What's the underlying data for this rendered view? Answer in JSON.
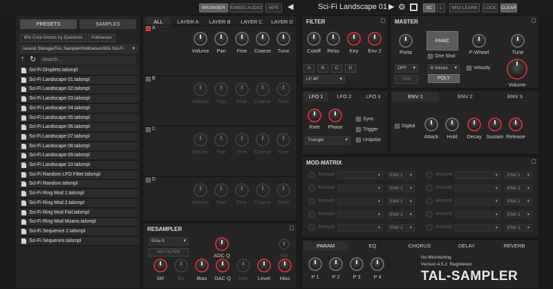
{
  "topbar": {
    "browser": "BROWSER",
    "embed_audio": "EMBED AUDIO",
    "mpe": "MPE",
    "preset_name": "Sci-Fi Landscape 01",
    "sc": "SC",
    "l": "L",
    "midi_learn": "MIDI LEARN",
    "lock": "LOCK",
    "clear": "CLEAR"
  },
  "sidebar": {
    "tabs": [
      "PRESETS",
      "SAMPLES"
    ],
    "chips": [
      "80s Core Drums by Quickmix",
      "Hollowsun"
    ],
    "path": "/sound Storage/TAL Sampler/Hollowsun/50s Sci-Fi",
    "search_placeholder": "Search...",
    "files": [
      "Sci-Fi Droplets.talsmpl",
      "Sci-Fi Landscape 01.talsmpl",
      "Sci-Fi Landscape 02.talsmpl",
      "Sci-Fi Landscape 03.talsmpl",
      "Sci-Fi Landscape 04.talsmpl",
      "Sci-Fi Landscape 05.talsmpl",
      "Sci-Fi Landscape 06.talsmpl",
      "Sci-Fi Landscape 07.talsmpl",
      "Sci-Fi Landscape 08.talsmpl",
      "Sci-Fi Landscape 09.talsmpl",
      "Sci-Fi Landscape 10.talsmpl",
      "Sci-Fi Random LFO Filter.talsmpl",
      "Sci-Fi Random.talsmpl",
      "Sci-Fi Ring Mod 1.talsmpl",
      "Sci-Fi Ring Mod 2.talsmpl",
      "Sci-Fi Ring Mod Fail.talsmpl",
      "Sci-Fi Ring Mod Moans.talsmpl",
      "Sci-Fi Sequence 2.talsmpl",
      "Sci-Fi Sequence.talsmpl"
    ]
  },
  "layers": {
    "tabs": [
      "ALL",
      "LAYER A",
      "LAYER B",
      "LAYER C",
      "LAYER D"
    ],
    "rows": [
      {
        "id": "A"
      },
      {
        "id": "B"
      },
      {
        "id": "C"
      },
      {
        "id": "D"
      }
    ],
    "knob_labels": [
      "Volume",
      "Pan",
      "Fine",
      "Coarse",
      "Tune"
    ]
  },
  "resampler": {
    "title": "RESAMPLER",
    "mode": "Emu II",
    "no_filter": "NO FILTER",
    "adc_q": "ADC Q",
    "sat": "Sat",
    "knobs": [
      "SR",
      "8/s",
      "Bias",
      "DAC Q",
      "Jitter",
      "Level",
      "Hiss"
    ]
  },
  "filter": {
    "title": "FILTER",
    "knobs": [
      "Cutoff",
      "Reso",
      "Key",
      "Env 2"
    ],
    "modes": [
      "A",
      "B",
      "C",
      "D"
    ],
    "type": "LP 4P"
  },
  "master": {
    "title": "MASTER",
    "porta": "Porta",
    "panic": "PANIC",
    "one_shot": "One Shot",
    "pwheel": "P-Wheel",
    "tune": "Tune",
    "off": "OFF",
    "voices": "8 Voices",
    "velocity": "Velocity",
    "time": "TIME",
    "poly": "POLY",
    "volume": "Volume"
  },
  "lfo": {
    "tabs": [
      "LFO 1",
      "LFO 2",
      "LFO 3"
    ],
    "rate": "Rate",
    "phase": "Phase",
    "sync": "Sync",
    "trigger": "Trigger",
    "unipolar": "Unipolar",
    "wave": "Triangle"
  },
  "env": {
    "tabs": [
      "ENV 1",
      "ENV 2",
      "ENV 3"
    ],
    "digital": "Digital",
    "knobs": [
      "Attack",
      "Hold",
      "Decay",
      "Sustain",
      "Release"
    ]
  },
  "modmatrix": {
    "title": "MOD-MATRIX",
    "amount": "Amount",
    "env": "ENV 1"
  },
  "bottom": {
    "tabs": [
      "PARAM",
      "EQ",
      "CHORUS",
      "DELAY",
      "REVERB"
    ],
    "no_microtuning": "No Microtuning",
    "version": "Version 4.5.2: Registered",
    "brand": "TAL-SAMPLER",
    "params": [
      "P 1",
      "P 2",
      "P 3",
      "P 4"
    ]
  },
  "colors": {
    "accent": "#c7303a",
    "panel": "#242424",
    "background": "#1b1b1b"
  }
}
